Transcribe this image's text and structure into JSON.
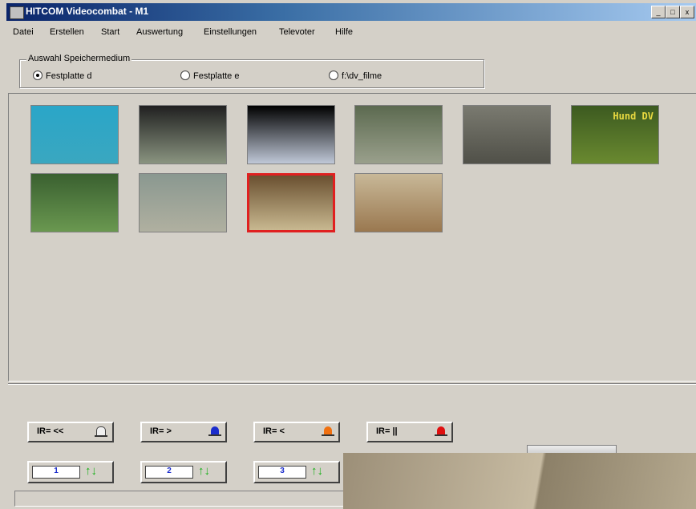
{
  "window": {
    "title": "HITCOM Videocombat - M1",
    "minimize": "_",
    "maximize": "□",
    "close": "x"
  },
  "menu": [
    "Datei",
    "Erstellen",
    "Start",
    "Auswertung",
    "Einstellungen",
    "Televoter",
    "Hilfe"
  ],
  "storage": {
    "legend": "Auswahl Speichermedium",
    "options": [
      {
        "label": "Festplatte d",
        "selected": true
      },
      {
        "label": "Festplatte e",
        "selected": false
      },
      {
        "label": "f:\\dv_filme",
        "selected": false
      }
    ]
  },
  "thumbnails": [
    {
      "caption": "",
      "colors": [
        "#2aa6c8",
        "#3aa7c0"
      ],
      "selected": false
    },
    {
      "caption": "",
      "colors": [
        "#202020",
        "#8a9480"
      ],
      "selected": false
    },
    {
      "caption": "",
      "colors": [
        "#000000",
        "#c0c8d8"
      ],
      "selected": false
    },
    {
      "caption": "",
      "colors": [
        "#5c6a50",
        "#9aa08c"
      ],
      "selected": false
    },
    {
      "caption": "",
      "colors": [
        "#7a7a70",
        "#505048"
      ],
      "selected": false
    },
    {
      "caption": "Hund DV",
      "colors": [
        "#3c5a20",
        "#6a8a30"
      ],
      "selected": false
    },
    {
      "caption": "",
      "colors": [
        "#3a6030",
        "#6a9850"
      ],
      "selected": false
    },
    {
      "caption": "",
      "colors": [
        "#8a9890",
        "#b0b0a0"
      ],
      "selected": false
    },
    {
      "caption": "",
      "colors": [
        "#6a5030",
        "#c8b890"
      ],
      "selected": true
    },
    {
      "caption": "",
      "colors": [
        "#c8b898",
        "#9a7850"
      ],
      "selected": false
    }
  ],
  "ir_buttons": [
    {
      "label": "IR= <<",
      "lamp": "#f0f0f0"
    },
    {
      "label": "IR= >",
      "lamp": "#1a2ccc"
    },
    {
      "label": "IR= <",
      "lamp": "#f07010"
    },
    {
      "label": "IR= ||",
      "lamp": "#e01010"
    }
  ],
  "cameras": [
    {
      "number": "1",
      "arrows": "↑↓"
    },
    {
      "number": "2",
      "arrows": "↑↓"
    },
    {
      "number": "3",
      "arrows": "↑↓"
    }
  ]
}
